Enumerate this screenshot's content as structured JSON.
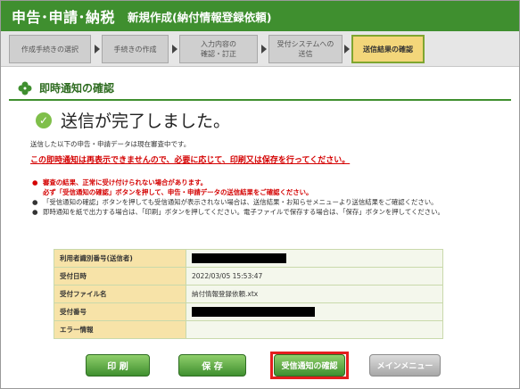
{
  "header": {
    "title": "申告･申請･納税",
    "subtitle": "新規作成(納付情報登録依頼)"
  },
  "steps": [
    {
      "label": "作成手続きの選択",
      "active": false
    },
    {
      "label": "手続きの作成",
      "active": false
    },
    {
      "label": "入力内容の\n確認・訂正",
      "active": false
    },
    {
      "label": "受付システムへの\n送信",
      "active": false
    },
    {
      "label": "送信結果の確認",
      "active": true
    }
  ],
  "section": {
    "title": "即時通知の確認"
  },
  "status": {
    "message": "送信が完了しました。"
  },
  "note": "送信した以下の申告・申請データは現在審査中です。",
  "warning": "この即時通知は再表示できませんので、必要に応じて、印刷又は保存を行ってください。",
  "bullets": [
    {
      "line1": "審査の結果、正常に受け付けられない場合があります。",
      "line2": "必ず「受信通知の確認」ボタンを押して、申告・申請データの送信結果をご確認ください。",
      "red": true
    },
    {
      "line1": "「受信通知の確認」ボタンを押しても受信通知が表示されない場合は、送信結果・お知らせメニューより送信結果をご確認ください。",
      "line2": "",
      "red": false
    },
    {
      "line1": "即時通知を紙で出力する場合は、「印刷」ボタンを押してください。電子ファイルで保存する場合は、「保存」ボタンを押してください。",
      "line2": "",
      "red": false
    }
  ],
  "info_table": {
    "rows": [
      {
        "label": "利用者識別番号(送信者)",
        "value": "",
        "redacted": true
      },
      {
        "label": "受付日時",
        "value": "2022/03/05 15:53:47",
        "redacted": false
      },
      {
        "label": "受付ファイル名",
        "value": "納付情報登録依頼.xtx",
        "redacted": false
      },
      {
        "label": "受付番号",
        "value": "",
        "redacted": true
      },
      {
        "label": "エラー情報",
        "value": "",
        "redacted": false
      }
    ]
  },
  "buttons": {
    "print": "印 刷",
    "save": "保 存",
    "receipt": "受信通知の確認",
    "main_menu": "メインメニュー"
  },
  "colors": {
    "header_green": "#3f8f2f",
    "active_step": "#f3d67a",
    "warning_red": "#d40000",
    "highlight_red": "#e41e1e"
  }
}
